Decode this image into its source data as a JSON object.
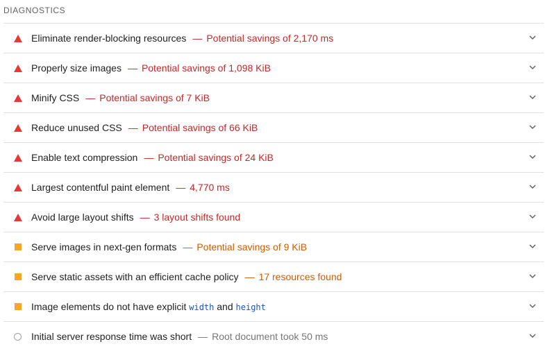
{
  "section": {
    "title": "DIAGNOSTICS"
  },
  "colors": {
    "fail": "#e53935",
    "average": "#f5a623",
    "pass": "#9e9e9e"
  },
  "audits": [
    {
      "status": "fail",
      "icon": "red-triangle-icon",
      "title": "Eliminate render-blocking resources",
      "detail": "Potential savings of 2,170 ms"
    },
    {
      "status": "fail",
      "icon": "red-triangle-icon",
      "title": "Properly size images",
      "detail": "Potential savings of 1,098 KiB"
    },
    {
      "status": "fail",
      "icon": "red-triangle-icon",
      "title": "Minify CSS",
      "detail": "Potential savings of 7 KiB"
    },
    {
      "status": "fail",
      "icon": "red-triangle-icon",
      "title": "Reduce unused CSS",
      "detail": "Potential savings of 66 KiB"
    },
    {
      "status": "fail",
      "icon": "red-triangle-icon",
      "title": "Enable text compression",
      "detail": "Potential savings of 24 KiB"
    },
    {
      "status": "fail",
      "icon": "red-triangle-icon",
      "title": "Largest contentful paint element",
      "detail": "4,770 ms"
    },
    {
      "status": "fail",
      "icon": "red-triangle-icon",
      "title": "Avoid large layout shifts",
      "detail": "3 layout shifts found"
    },
    {
      "status": "average",
      "icon": "orange-square-icon",
      "title": "Serve images in next-gen formats",
      "detail": "Potential savings of 9 KiB"
    },
    {
      "status": "average",
      "icon": "orange-square-icon",
      "title": "Serve static assets with an efficient cache policy",
      "detail": "17 resources found"
    },
    {
      "status": "average",
      "icon": "orange-square-icon",
      "title_parts": [
        "Image elements do not have explicit ",
        "width",
        " and ",
        "height"
      ]
    },
    {
      "status": "pass",
      "icon": "gray-circle-icon",
      "title": "Initial server response time was short",
      "detail": "Root document took 50 ms"
    }
  ],
  "dash": "—"
}
